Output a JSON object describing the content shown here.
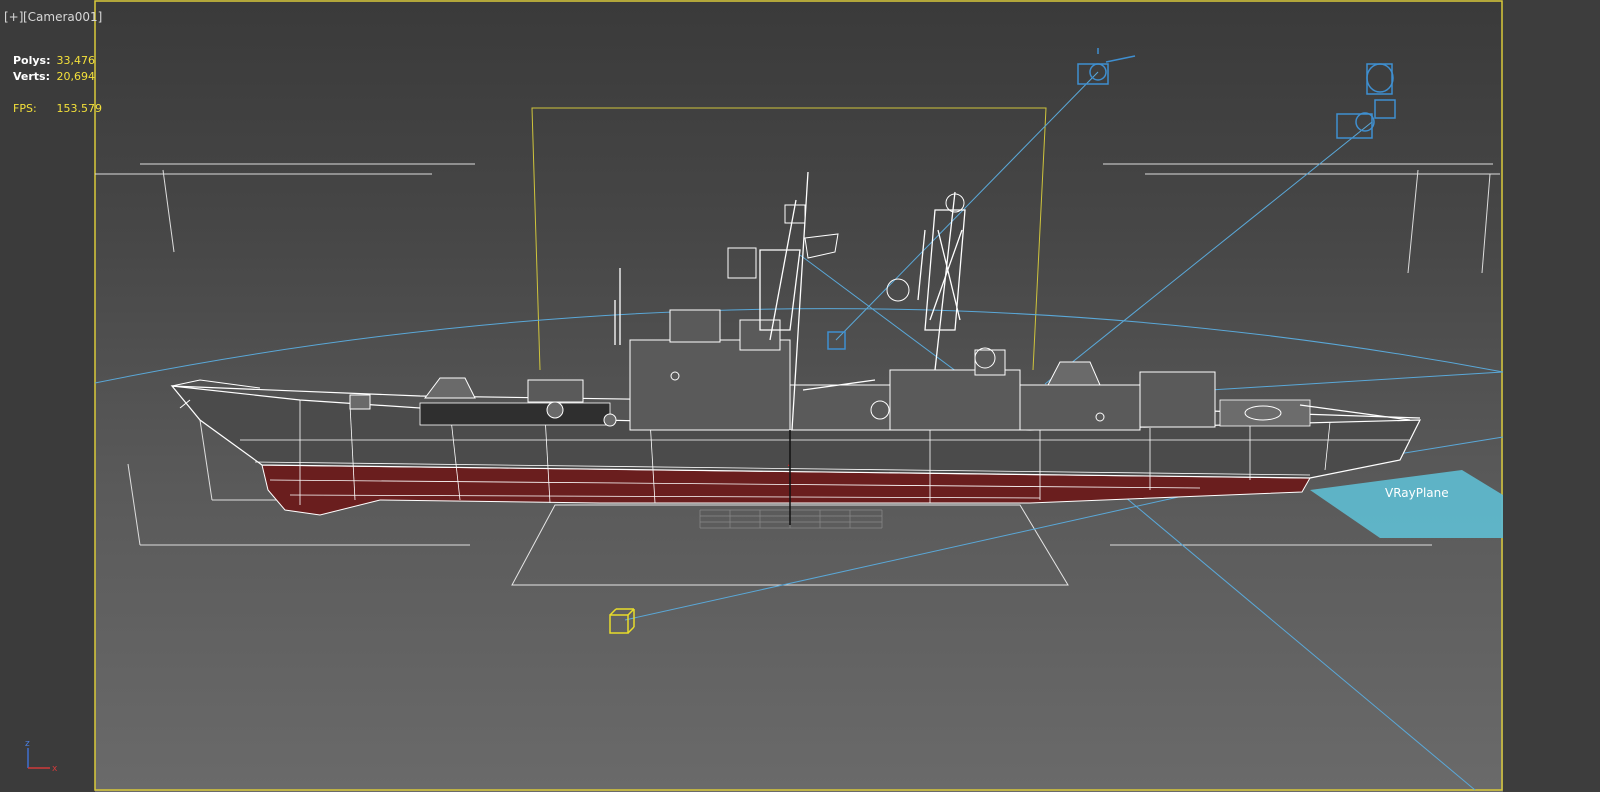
{
  "viewport": {
    "plus_label": "[+]",
    "camera_label": "[Camera001]"
  },
  "stats": {
    "polys_label": "Polys:",
    "polys_value": "33,476",
    "verts_label": "Verts:",
    "verts_value": "20,694",
    "fps_label": "FPS:",
    "fps_value": "153.579"
  },
  "scene": {
    "plane_label": "VRayPlane",
    "colors": {
      "frame": "#d9c93a",
      "wire": "#ffffff",
      "camera": "#5aa8d8",
      "light": "#3f8fd0",
      "hull_red": "#6a1e1e",
      "plane": "#5fb8cc",
      "selected_box": "#e8dc2a"
    }
  },
  "gizmo": {
    "z": "z",
    "x": "x"
  }
}
